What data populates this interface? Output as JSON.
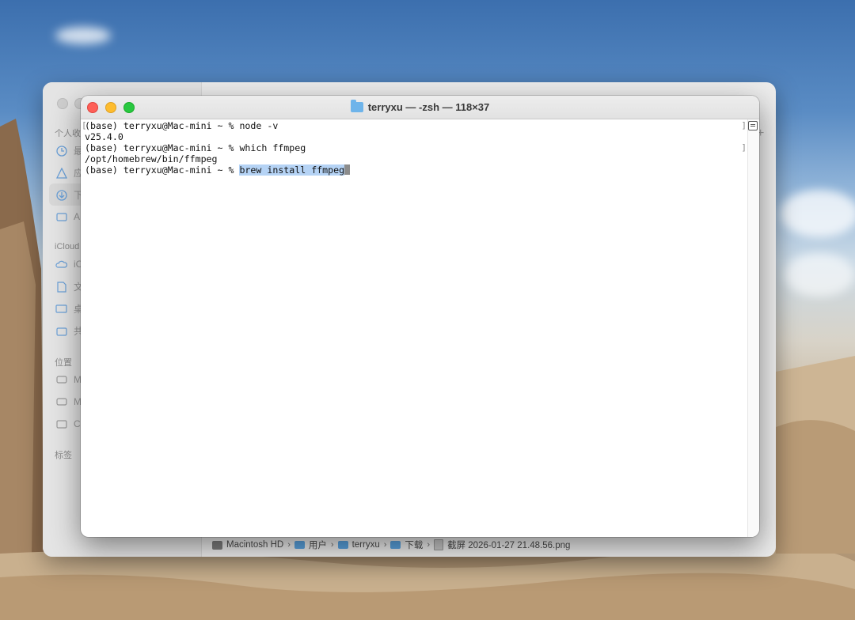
{
  "finder": {
    "sidebar_sections": [
      "个人收",
      "iCloud",
      "位置",
      "标签"
    ],
    "sidebar_items_favorites": [
      "最",
      "应",
      "下",
      "A"
    ],
    "sidebar_items_icloud": [
      "iC",
      "文",
      "桌",
      "共"
    ],
    "sidebar_items_locations": [
      "M",
      "M",
      "C"
    ],
    "pathbar": [
      "Macintosh HD",
      "用户",
      "terryxu",
      "下载",
      "截屏 2026-01-27 21.48.56.png"
    ]
  },
  "terminal": {
    "title": "terryxu — -zsh — 118×37",
    "lines": [
      "(base) terryxu@Mac-mini ~ % node -v",
      "v25.4.0",
      "(base) terryxu@Mac-mini ~ % which ffmpeg",
      "/opt/homebrew/bin/ffmpeg"
    ],
    "prompt": "(base) terryxu@Mac-mini ~ % ",
    "current_command": "brew install ffmpeg"
  },
  "colors": {
    "close": "#fe5f57",
    "minimize": "#febc2e",
    "zoom": "#28c840",
    "selection": "#b5d3f5",
    "folder": "#6eb4ea"
  }
}
